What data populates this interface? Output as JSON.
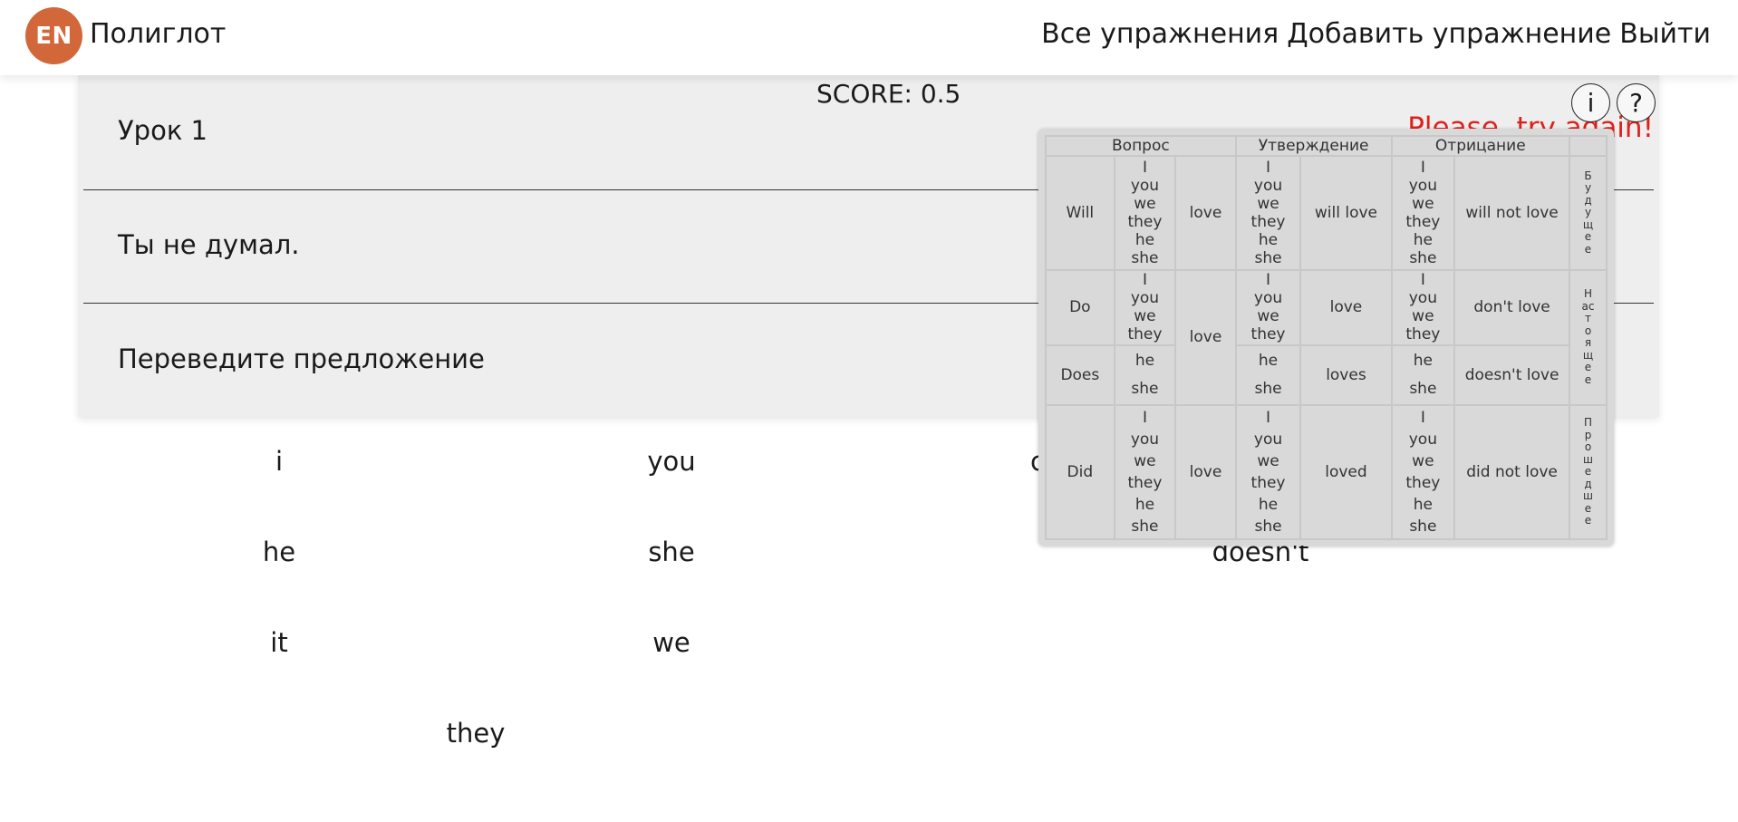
{
  "header": {
    "logo": "EN",
    "brand": "Полиглот",
    "nav": [
      "Все упражнения",
      "Добавить упражнение",
      "Выйти"
    ]
  },
  "lesson": {
    "title": "Урок 1",
    "sentence": "Ты не думал.",
    "instruction": "Переведите предложение",
    "score": "SCORE: 0.5",
    "message": "Please, try again!",
    "info_button": "i",
    "help_button": "?"
  },
  "words": [
    {
      "text": "i"
    },
    {
      "text": "you"
    },
    {
      "text": "c"
    },
    {
      "text": "he"
    },
    {
      "text": "she"
    },
    {
      "text": "doesn't"
    },
    {
      "text": "it"
    },
    {
      "text": "we"
    },
    {
      "text": "they"
    }
  ],
  "grammar": {
    "headers": [
      "Вопрос",
      "Утверждение",
      "Отрицание"
    ],
    "future": {
      "aux": "Will",
      "pronouns": [
        "I",
        "you",
        "we",
        "they",
        "he",
        "she"
      ],
      "q_verb": "love",
      "affirmative": "will love",
      "negative": "will not love",
      "label": "Будущее"
    },
    "present": {
      "aux_plural": "Do",
      "aux_singular": "Does",
      "pronouns_plural": [
        "I",
        "you",
        "we",
        "they"
      ],
      "pronouns_singular": [
        "he",
        "she"
      ],
      "q_verb": "love",
      "affirmative_plural": "love",
      "affirmative_singular": "loves",
      "negative_plural": "don't love",
      "negative_singular": "doesn't love",
      "label": "Настоящее"
    },
    "past": {
      "aux": "Did",
      "pronouns": [
        "I",
        "you",
        "we",
        "they",
        "he",
        "she"
      ],
      "q_verb": "love",
      "affirmative": "loved",
      "negative": "did not love",
      "label": "Прошедшее"
    }
  }
}
